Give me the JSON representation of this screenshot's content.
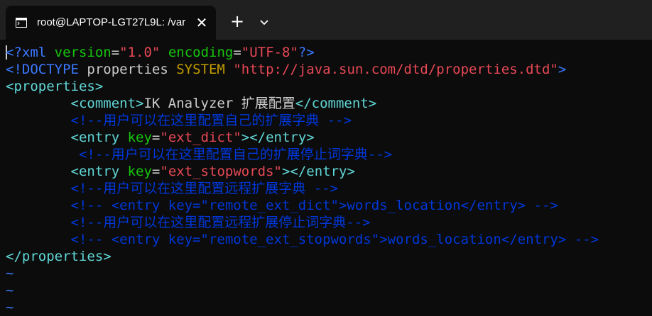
{
  "window": {
    "tab_title": "root@LAPTOP-LGT27L9L: /var",
    "tab_close": "✕",
    "new_tab": "+",
    "icons": {
      "terminal": "terminal-icon",
      "close": "close-icon",
      "plus": "plus-icon",
      "dropdown": "chevron-down-icon"
    }
  },
  "lines": [
    {
      "segments": [
        {
          "t": "<?xml ",
          "c": "b"
        },
        {
          "t": "version",
          "c": "g"
        },
        {
          "t": "=",
          "c": "w"
        },
        {
          "t": "\"1.0\"",
          "c": "s"
        },
        {
          "t": " ",
          "c": "w"
        },
        {
          "t": "encoding",
          "c": "g"
        },
        {
          "t": "=",
          "c": "w"
        },
        {
          "t": "\"UTF-8\"",
          "c": "s"
        },
        {
          "t": "?>",
          "c": "b"
        }
      ]
    },
    {
      "segments": [
        {
          "t": "<!DOCTYPE ",
          "c": "b"
        },
        {
          "t": "properties ",
          "c": "w"
        },
        {
          "t": "SYSTEM ",
          "c": "y"
        },
        {
          "t": "\"http://java.sun.com/dtd/properties.dtd\"",
          "c": "s"
        },
        {
          "t": ">",
          "c": "b"
        }
      ]
    },
    {
      "segments": [
        {
          "t": "<properties>",
          "c": "lb"
        }
      ]
    },
    {
      "segments": [
        {
          "t": "        ",
          "c": "w"
        },
        {
          "t": "<comment>",
          "c": "lb"
        },
        {
          "t": "IK Analyzer 扩展配置",
          "c": "w"
        },
        {
          "t": "</comment>",
          "c": "lb"
        }
      ]
    },
    {
      "segments": [
        {
          "t": "        <!--用户可以在这里配置自己的扩展字典 -->",
          "c": "d"
        }
      ]
    },
    {
      "segments": [
        {
          "t": "        ",
          "c": "w"
        },
        {
          "t": "<entry ",
          "c": "lb"
        },
        {
          "t": "key",
          "c": "g"
        },
        {
          "t": "=",
          "c": "w"
        },
        {
          "t": "\"ext_dict\"",
          "c": "s"
        },
        {
          "t": "></entry>",
          "c": "lb"
        }
      ]
    },
    {
      "segments": [
        {
          "t": "         <!--用户可以在这里配置自己的扩展停止词字典-->",
          "c": "d"
        }
      ]
    },
    {
      "segments": [
        {
          "t": "        ",
          "c": "w"
        },
        {
          "t": "<entry ",
          "c": "lb"
        },
        {
          "t": "key",
          "c": "g"
        },
        {
          "t": "=",
          "c": "w"
        },
        {
          "t": "\"ext_stopwords\"",
          "c": "s"
        },
        {
          "t": "></entry>",
          "c": "lb"
        }
      ]
    },
    {
      "segments": [
        {
          "t": "        <!--用户可以在这里配置远程扩展字典 -->",
          "c": "d"
        }
      ]
    },
    {
      "segments": [
        {
          "t": "        <!-- <entry key=\"remote_ext_dict\">words_location</entry> -->",
          "c": "d"
        }
      ]
    },
    {
      "segments": [
        {
          "t": "        <!--用户可以在这里配置远程扩展停止词字典-->",
          "c": "d"
        }
      ]
    },
    {
      "segments": [
        {
          "t": "        <!-- <entry key=\"remote_ext_stopwords\">words_location</entry> -->",
          "c": "d"
        }
      ]
    },
    {
      "segments": [
        {
          "t": "</properties>",
          "c": "lb"
        }
      ]
    }
  ],
  "tildes": [
    "~",
    "~",
    "~"
  ]
}
